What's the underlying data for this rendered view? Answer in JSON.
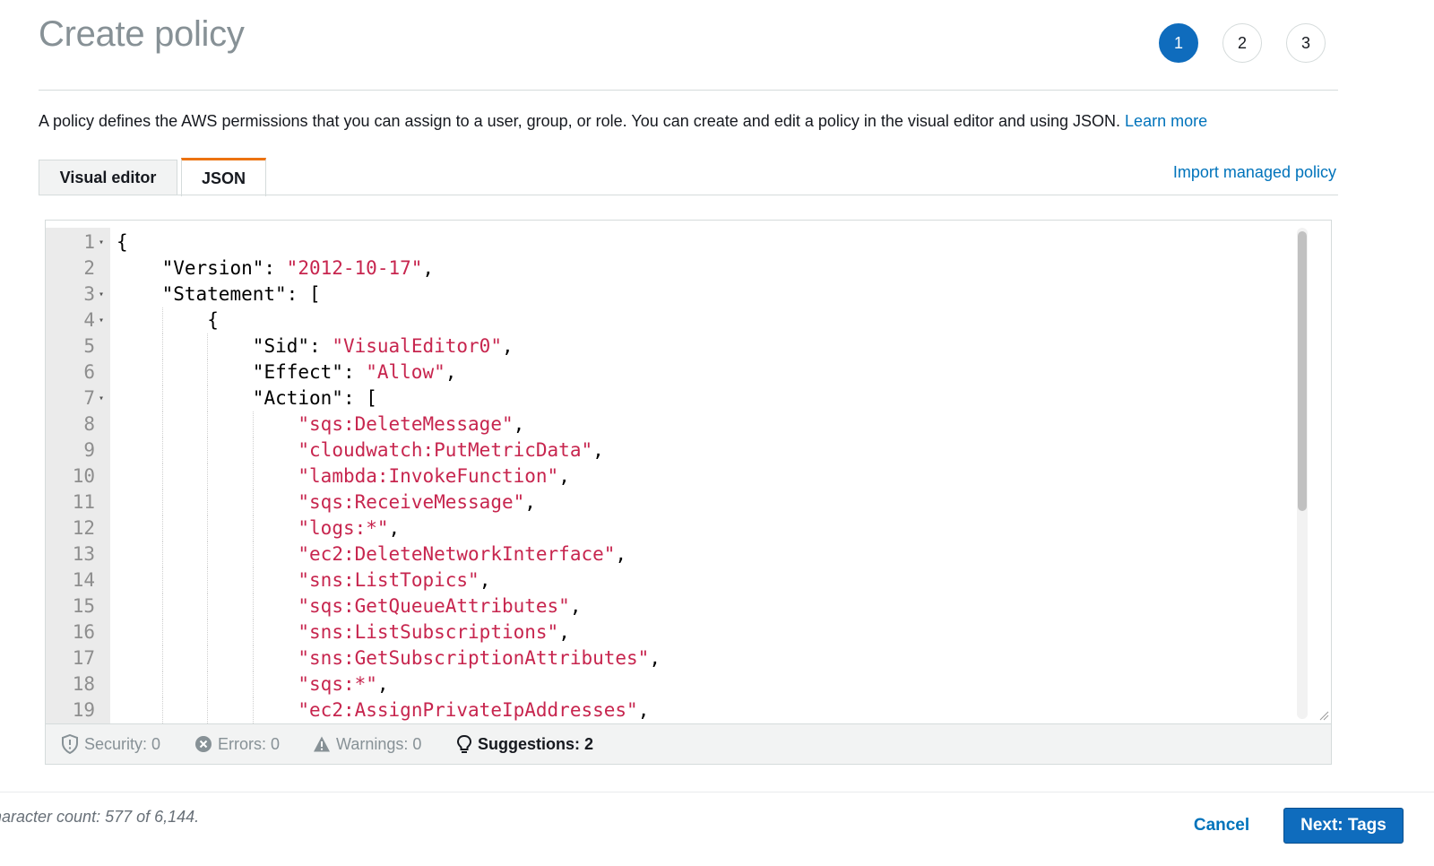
{
  "header": {
    "title": "Create policy",
    "steps": [
      "1",
      "2",
      "3"
    ],
    "active_step": "1"
  },
  "description": {
    "text": "A policy defines the AWS permissions that you can assign to a user, group, or role. You can create and edit a policy in the visual editor and using JSON.",
    "link": "Learn more"
  },
  "tabs": [
    {
      "label": "Visual editor",
      "selected": false
    },
    {
      "label": "JSON",
      "selected": true
    }
  ],
  "import_link": "Import managed policy",
  "editor": {
    "lines": [
      {
        "n": "1",
        "fold": true,
        "indent": 0,
        "parts": [
          {
            "t": "{",
            "s": false
          }
        ]
      },
      {
        "n": "2",
        "fold": false,
        "indent": 1,
        "parts": [
          {
            "t": "\"Version\": ",
            "s": false
          },
          {
            "t": "\"2012-10-17\"",
            "s": true
          },
          {
            "t": ",",
            "s": false
          }
        ]
      },
      {
        "n": "3",
        "fold": true,
        "indent": 1,
        "parts": [
          {
            "t": "\"Statement\": [",
            "s": false
          }
        ]
      },
      {
        "n": "4",
        "fold": true,
        "indent": 2,
        "parts": [
          {
            "t": "{",
            "s": false
          }
        ]
      },
      {
        "n": "5",
        "fold": false,
        "indent": 3,
        "parts": [
          {
            "t": "\"Sid\": ",
            "s": false
          },
          {
            "t": "\"VisualEditor0\"",
            "s": true
          },
          {
            "t": ",",
            "s": false
          }
        ]
      },
      {
        "n": "6",
        "fold": false,
        "indent": 3,
        "parts": [
          {
            "t": "\"Effect\": ",
            "s": false
          },
          {
            "t": "\"Allow\"",
            "s": true
          },
          {
            "t": ",",
            "s": false
          }
        ]
      },
      {
        "n": "7",
        "fold": true,
        "indent": 3,
        "parts": [
          {
            "t": "\"Action\": [",
            "s": false
          }
        ]
      },
      {
        "n": "8",
        "fold": false,
        "indent": 4,
        "parts": [
          {
            "t": "\"sqs:DeleteMessage\"",
            "s": true
          },
          {
            "t": ",",
            "s": false
          }
        ]
      },
      {
        "n": "9",
        "fold": false,
        "indent": 4,
        "parts": [
          {
            "t": "\"cloudwatch:PutMetricData\"",
            "s": true
          },
          {
            "t": ",",
            "s": false
          }
        ]
      },
      {
        "n": "10",
        "fold": false,
        "indent": 4,
        "parts": [
          {
            "t": "\"lambda:InvokeFunction\"",
            "s": true
          },
          {
            "t": ",",
            "s": false
          }
        ]
      },
      {
        "n": "11",
        "fold": false,
        "indent": 4,
        "parts": [
          {
            "t": "\"sqs:ReceiveMessage\"",
            "s": true
          },
          {
            "t": ",",
            "s": false
          }
        ]
      },
      {
        "n": "12",
        "fold": false,
        "indent": 4,
        "parts": [
          {
            "t": "\"logs:*\"",
            "s": true
          },
          {
            "t": ",",
            "s": false
          }
        ]
      },
      {
        "n": "13",
        "fold": false,
        "indent": 4,
        "parts": [
          {
            "t": "\"ec2:DeleteNetworkInterface\"",
            "s": true
          },
          {
            "t": ",",
            "s": false
          }
        ]
      },
      {
        "n": "14",
        "fold": false,
        "indent": 4,
        "parts": [
          {
            "t": "\"sns:ListTopics\"",
            "s": true
          },
          {
            "t": ",",
            "s": false
          }
        ]
      },
      {
        "n": "15",
        "fold": false,
        "indent": 4,
        "parts": [
          {
            "t": "\"sqs:GetQueueAttributes\"",
            "s": true
          },
          {
            "t": ",",
            "s": false
          }
        ]
      },
      {
        "n": "16",
        "fold": false,
        "indent": 4,
        "parts": [
          {
            "t": "\"sns:ListSubscriptions\"",
            "s": true
          },
          {
            "t": ",",
            "s": false
          }
        ]
      },
      {
        "n": "17",
        "fold": false,
        "indent": 4,
        "parts": [
          {
            "t": "\"sns:GetSubscriptionAttributes\"",
            "s": true
          },
          {
            "t": ",",
            "s": false
          }
        ]
      },
      {
        "n": "18",
        "fold": false,
        "indent": 4,
        "parts": [
          {
            "t": "\"sqs:*\"",
            "s": true
          },
          {
            "t": ",",
            "s": false
          }
        ]
      },
      {
        "n": "19",
        "fold": false,
        "indent": 4,
        "parts": [
          {
            "t": "\"ec2:AssignPrivateIpAddresses\"",
            "s": true
          },
          {
            "t": ",",
            "s": false
          }
        ]
      }
    ]
  },
  "status_bar": {
    "security": "Security: 0",
    "errors": "Errors: 0",
    "warnings": "Warnings: 0",
    "suggestions": "Suggestions: 2"
  },
  "footer": {
    "char_count": "haracter count: 577 of 6,144.",
    "cancel_label": "Cancel",
    "next_label": "Next: Tags"
  },
  "colors": {
    "primary": "#0f6cbd",
    "link": "#0073bb",
    "tab_accent": "#ec7211",
    "string": "#c7254e"
  }
}
